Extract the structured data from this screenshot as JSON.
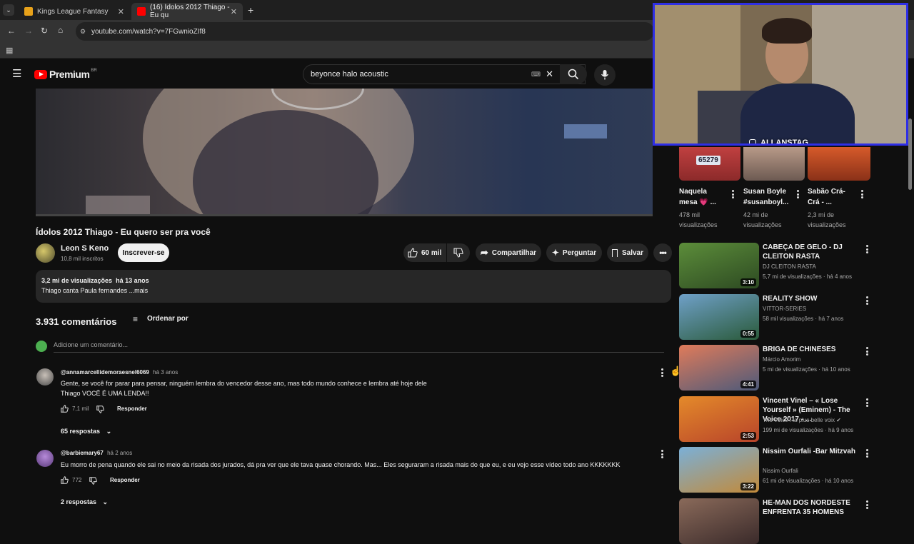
{
  "browser": {
    "tabs": [
      {
        "label": "Kings League Fantasy"
      },
      {
        "label": "(16) Ídolos 2012 Thiago - Eu qu"
      }
    ],
    "url": "youtube.com/watch?v=7FGwnioZIf8"
  },
  "header": {
    "logo": "Premium",
    "region": "BR",
    "search_value": "beyonce halo acoustic"
  },
  "webcam": {
    "handle": "ALLANSTAG"
  },
  "video": {
    "title": "Ídolos 2012 Thiago - Eu quero ser pra você",
    "channel": "Leon S Keno",
    "subscribers": "10,8 mil inscritos",
    "subscribe_label": "Inscrever-se",
    "likes": "60 mil",
    "share_label": "Compartilhar",
    "ask_label": "Perguntar",
    "save_label": "Salvar",
    "views": "3,2 mi de visualizações",
    "age": "há 13 anos",
    "description": "Thiago canta Paula fernandes ...mais"
  },
  "comments": {
    "count": "3.931 comentários",
    "sort_label": "Ordenar por",
    "add_placeholder": "Adicione um comentário...",
    "items": [
      {
        "author": "@annamarcellidemoraesnel6069",
        "time": "há 3 anos",
        "text1": "Gente, se você for parar para pensar, ninguém lembra do vencedor desse ano, mas todo mundo conhece e lembra até hoje dele",
        "text2": "Thiago VOCÊ É UMA LENDA!!",
        "likes": "7,1 mil",
        "reply_label": "Responder",
        "replies": "65 respostas"
      },
      {
        "author": "@barbiemary67",
        "time": "há 2 anos",
        "text1": "Eu morro de pena quando ele sai no meio da risada dos jurados, dá pra ver que ele tava quase chorando. Mas... Eles seguraram a risada mais do que eu, e eu vejo esse vídeo todo ano KKKKKKK",
        "likes": "772",
        "reply_label": "Responder",
        "replies": "2 respostas"
      }
    ]
  },
  "shorts": [
    {
      "badge": "65279",
      "title1": "Naquela",
      "title2": "mesa 💗 ...",
      "meta1": "478 mil",
      "meta2": "visualizações"
    },
    {
      "title1": "Susan Boyle",
      "title2": "#susanboyl...",
      "meta1": "42 mi de",
      "meta2": "visualizações"
    },
    {
      "title1": "Sabão Crá-",
      "title2": "Crá - ...",
      "meta1": "2,3 mi de",
      "meta2": "visualizações"
    }
  ],
  "related": [
    {
      "title": "CABEÇA DE GELO - DJ CLEITON RASTA",
      "channel": "DJ CLEITON RASTA",
      "meta": "5,7 mi de visualizações · há 4 anos",
      "duration": "3:10"
    },
    {
      "title": "REALITY SHOW",
      "channel": "VITTOR-SERIES",
      "meta": "58 mil visualizações · há 7 anos",
      "duration": "0:55"
    },
    {
      "title": "BRIGA DE CHINESES",
      "channel": "Márcio Amorim",
      "meta": "5 mi de visualizações · há 10 anos",
      "duration": "4:41"
    },
    {
      "title": "Vincent Vinel – « Lose Yourself » (Eminem) - The Voice 2017 - ...",
      "channel": "The Voice : la plus belle voix ✔",
      "meta": "199 mi de visualizações · há 9 anos",
      "duration": "2:53"
    },
    {
      "title": "Nissim Ourfali -Bar Mitzvah",
      "channel": "Nissim Ourfali",
      "meta": "61 mi de visualizações · há 10 anos",
      "duration": "3:22"
    },
    {
      "title": "HE-MAN DOS NORDESTE ENFRENTA 35 HOMENS",
      "channel": "",
      "meta": "",
      "duration": ""
    }
  ]
}
